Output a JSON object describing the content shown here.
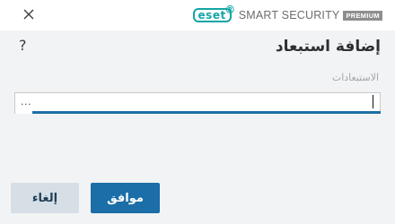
{
  "header": {
    "brand_logo_text": "eset",
    "product_name": "SMART SECURITY",
    "edition_badge": "PREMIUM",
    "close_icon": "close-icon"
  },
  "dialog": {
    "help_label": "?",
    "title": "إضافة استبعاد",
    "field_label": "الاستبعادات",
    "field_value": "..."
  },
  "buttons": {
    "ok_label": "موافق",
    "cancel_label": "إلغاء"
  },
  "colors": {
    "accent": "#1b6ea8",
    "brand": "#14a5a5",
    "cancel_bg": "#d6dee6"
  }
}
